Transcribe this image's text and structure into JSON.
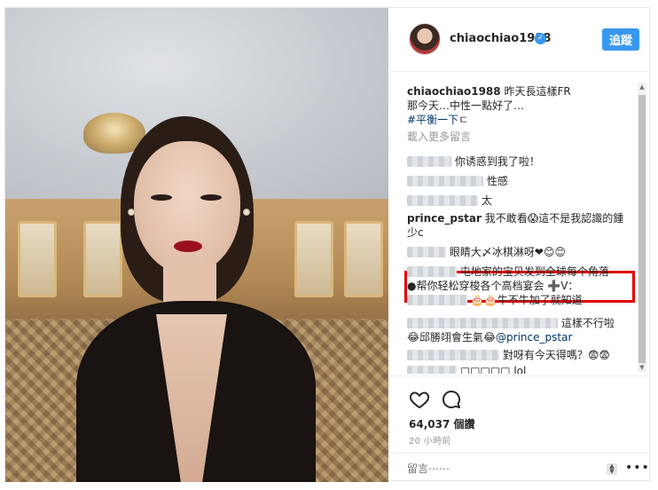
{
  "header": {
    "username": "chiaochiao1988",
    "verified_glyph": "✓",
    "follow_label": "追蹤"
  },
  "caption": {
    "username": "chiaochiao1988",
    "line1": " 昨天長這樣FR",
    "line2": "那今天…中性一點好了…",
    "hashtag": "#平衡一下"
  },
  "load_more": "載入更多留言",
  "comments": [
    {
      "text": "你诱惑到我了啦！"
    },
    {
      "text": "性感"
    },
    {
      "text": "太"
    },
    {
      "user": "prince_pstar",
      "line1": " 我不敢看😱這不是我認識的鍾",
      "line2": "少c"
    },
    {
      "text": "眼睛大〆冰棋淋呀❤😊😊"
    },
    {
      "line1": "屯地家的宝贝发到全球每个角落",
      "line2": "●帮你轻松穿梭各个高档宴会 ➕V：",
      "line3": "🎂🎂牛不牛加了就知道"
    },
    {
      "text": "這樣不行啦",
      "line2": "😂邱勝翊會生氣😂",
      "mention": "@prince_pstar"
    },
    {
      "text": "對呀有今天得嗎？😨😨"
    },
    {
      "text": "□□□□□ lol"
    }
  ],
  "actions": {
    "likes": "64,037 個讚",
    "time": "20 小時前",
    "comment_placeholder": "留言⋯⋯"
  },
  "colors": {
    "accent": "#3897f0",
    "highlight_box": "#e00000",
    "text_primary": "#262626",
    "text_muted": "#999999"
  },
  "icons": [
    "heart-icon",
    "comment-bubble-icon",
    "verified-badge-icon",
    "sort-icon",
    "more-options-icon"
  ]
}
